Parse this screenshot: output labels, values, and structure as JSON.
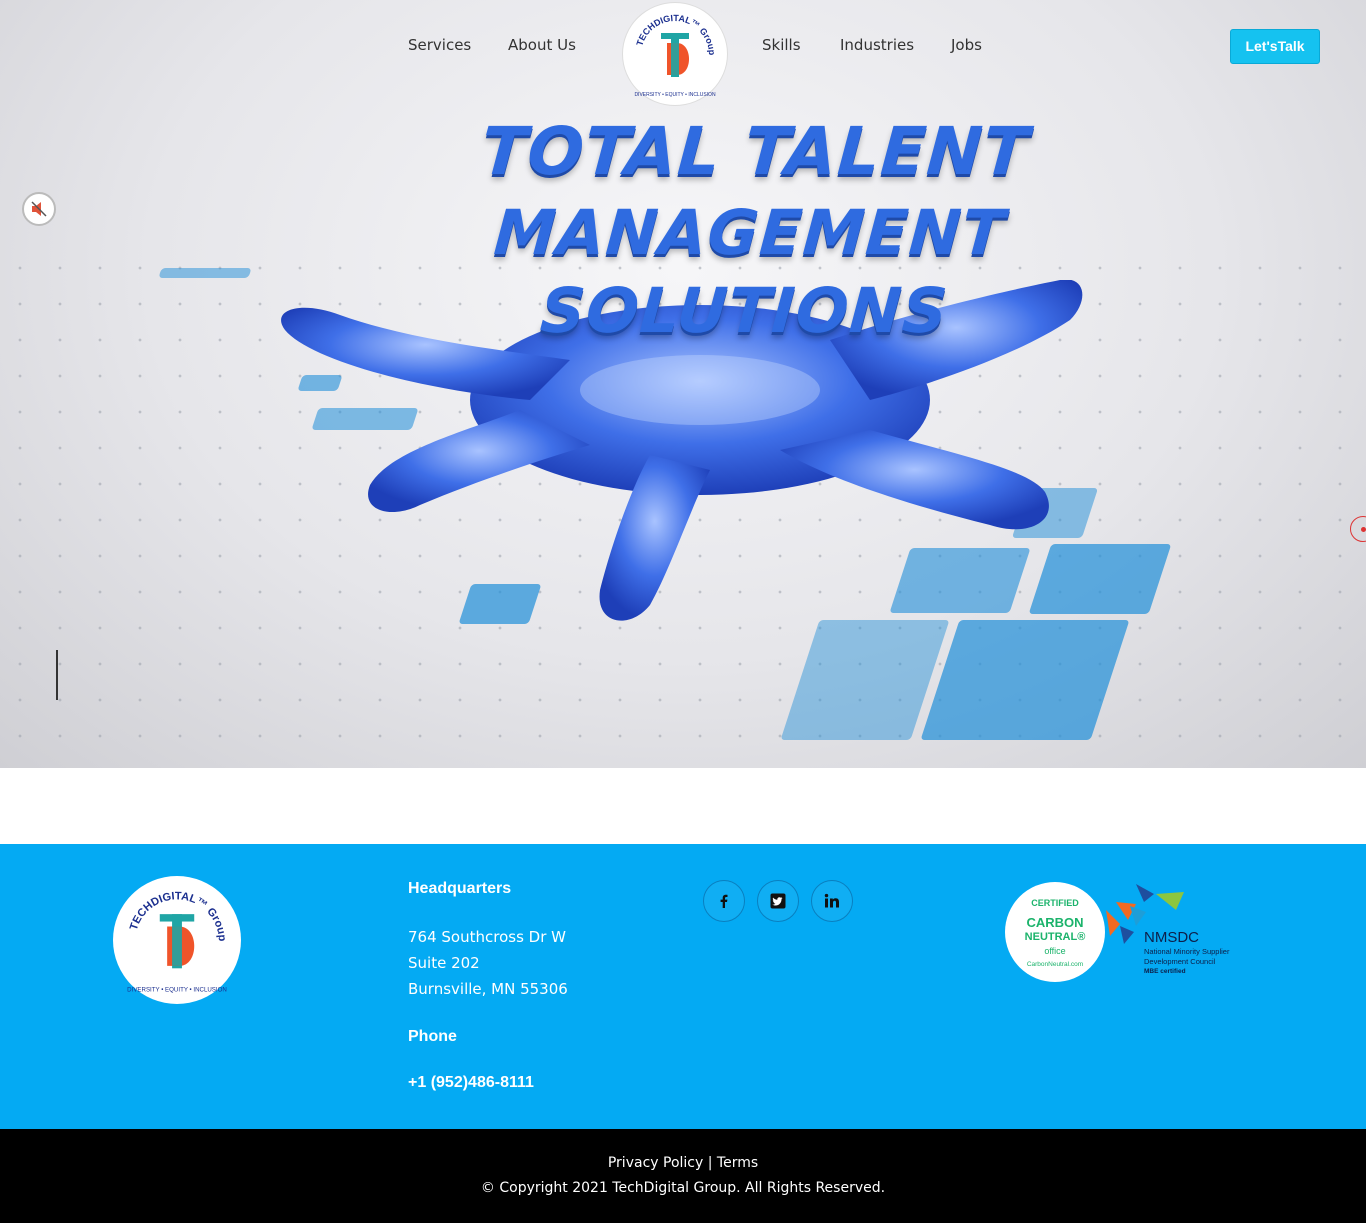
{
  "nav": {
    "items": [
      "Services",
      "About Us",
      "Skills",
      "Industries",
      "Jobs"
    ],
    "cta_label": "Let'sTalk"
  },
  "brand": {
    "logo_arc_text": "TECHDIGITAL™ Group",
    "logo_bottom_text": "DIVERSITY • EQUITY • INCLUSION",
    "logo_letters": "TD",
    "colors": {
      "teal": "#1fa5a5",
      "orange": "#ef4b1f",
      "navy": "#1b2f8f",
      "accent": "#15c2f0",
      "footer": "#04aaf3"
    }
  },
  "hero": {
    "title_line1": "TOTAL TALENT",
    "title_line2": "MANAGEMENT SOLUTIONS",
    "mute_icon": "speaker-muted-icon"
  },
  "footer": {
    "hq_heading": "Headquarters",
    "address": [
      "764 Southcross Dr W",
      "Suite 202",
      "Burnsville, MN 55306"
    ],
    "phone_heading": "Phone",
    "phone": "+1 (952)486-8111",
    "social": [
      {
        "name": "facebook-icon",
        "glyph": "f"
      },
      {
        "name": "twitter-icon",
        "glyph": "t"
      },
      {
        "name": "linkedin-icon",
        "glyph": "in"
      }
    ],
    "carbon_badge": {
      "top": "CERTIFIED",
      "mid1": "CARBON",
      "mid2": "NEUTRAL®",
      "sub": "office",
      "url": "CarbonNeutral.com"
    },
    "nmsdc": {
      "title": "NMSDC",
      "line1": "National Minority Supplier",
      "line2": "Development Council",
      "line3": "MBE certified"
    }
  },
  "bottom": {
    "privacy": "Privacy Policy",
    "sep": "|",
    "terms": "Terms",
    "copyright": "© Copyright 2021 TechDigital Group. All Rights Reserved."
  }
}
